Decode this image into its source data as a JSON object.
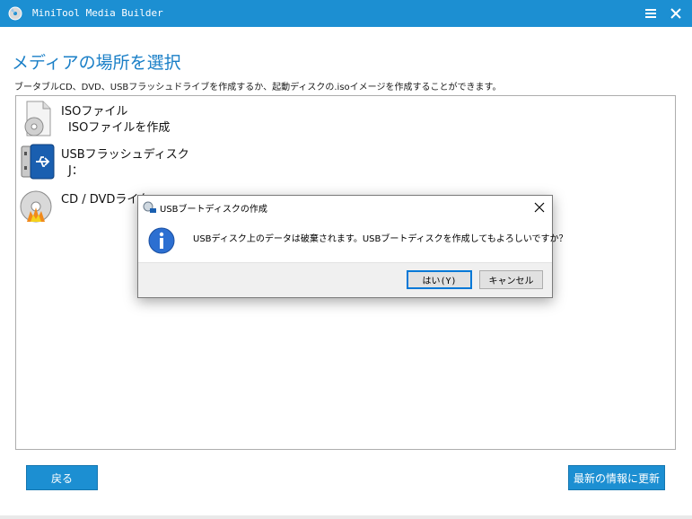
{
  "window": {
    "title": "MiniTool Media Builder",
    "accent_color": "#1c8fd2",
    "icons": {
      "app": "disc-icon",
      "menu": "hamburger-menu-icon",
      "close": "close-icon"
    }
  },
  "page": {
    "title": "メディアの場所を選択",
    "description": "ブータブルCD、DVD、USBフラッシュドライブを作成するか、起動ディスクの.isoイメージを作成することができます。"
  },
  "media_items": [
    {
      "name": "ISOファイル",
      "sub": "ISOファイルを作成",
      "icon": "iso-file-icon"
    },
    {
      "name": "USBフラッシュディスク",
      "sub": "J：",
      "icon": "usb-drive-icon"
    },
    {
      "name": "CD / DVDライタ",
      "sub": "",
      "icon": "cd-dvd-burner-icon"
    }
  ],
  "buttons": {
    "back": "戻る",
    "refresh": "最新の情報に更新"
  },
  "dialog": {
    "title": "USBブートディスクの作成",
    "message": "USBディスク上のデータは破棄されます。USBブートディスクを作成してもよろしいですか？",
    "yes": "はい(Y)",
    "cancel": "キャンセル",
    "icons": {
      "title": "usb-boot-icon",
      "message": "info-icon",
      "close": "close-icon"
    }
  }
}
